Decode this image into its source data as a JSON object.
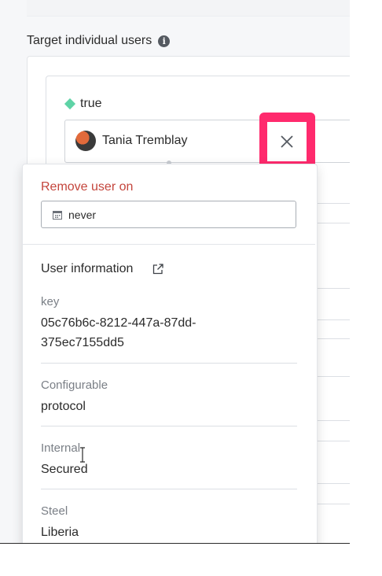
{
  "section": {
    "title": "Target individual users",
    "info_icon": "info-icon"
  },
  "variation": {
    "label": "true",
    "color": "#5ed3a6"
  },
  "selected_user": {
    "name": "Tania Tremblay"
  },
  "popover": {
    "remove_title": "Remove user on",
    "date_value": "never",
    "user_info_title": "User information",
    "fields": [
      {
        "label": "key",
        "value": "05c76b6c-8212-447a-87dd-375ec7155dd5"
      },
      {
        "label": "Configurable",
        "value": "protocol"
      },
      {
        "label": "Internal",
        "value": "Secured"
      },
      {
        "label": "Steel",
        "value": "Liberia"
      }
    ]
  },
  "colors": {
    "highlight": "#ff2a6d",
    "remove_title": "#c4453c"
  }
}
